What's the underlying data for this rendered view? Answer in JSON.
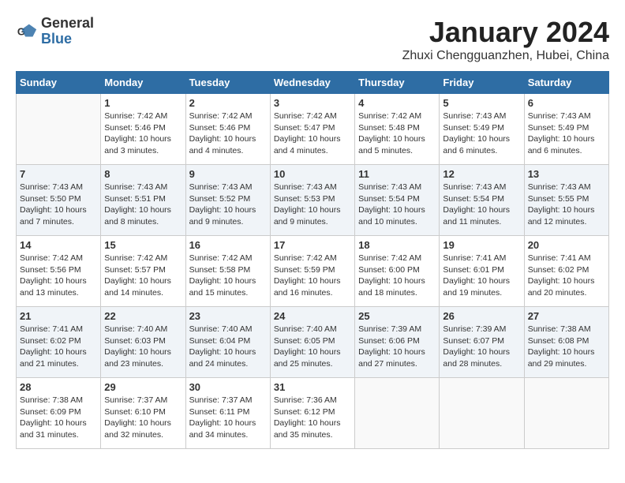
{
  "header": {
    "logo_general": "General",
    "logo_blue": "Blue",
    "month_title": "January 2024",
    "location": "Zhuxi Chengguanzhen, Hubei, China"
  },
  "days_of_week": [
    "Sunday",
    "Monday",
    "Tuesday",
    "Wednesday",
    "Thursday",
    "Friday",
    "Saturday"
  ],
  "weeks": [
    [
      {
        "date": "",
        "sunrise": "",
        "sunset": "",
        "daylight": "",
        "empty": true
      },
      {
        "date": "1",
        "sunrise": "Sunrise: 7:42 AM",
        "sunset": "Sunset: 5:46 PM",
        "daylight": "Daylight: 10 hours and 3 minutes."
      },
      {
        "date": "2",
        "sunrise": "Sunrise: 7:42 AM",
        "sunset": "Sunset: 5:46 PM",
        "daylight": "Daylight: 10 hours and 4 minutes."
      },
      {
        "date": "3",
        "sunrise": "Sunrise: 7:42 AM",
        "sunset": "Sunset: 5:47 PM",
        "daylight": "Daylight: 10 hours and 4 minutes."
      },
      {
        "date": "4",
        "sunrise": "Sunrise: 7:42 AM",
        "sunset": "Sunset: 5:48 PM",
        "daylight": "Daylight: 10 hours and 5 minutes."
      },
      {
        "date": "5",
        "sunrise": "Sunrise: 7:43 AM",
        "sunset": "Sunset: 5:49 PM",
        "daylight": "Daylight: 10 hours and 6 minutes."
      },
      {
        "date": "6",
        "sunrise": "Sunrise: 7:43 AM",
        "sunset": "Sunset: 5:49 PM",
        "daylight": "Daylight: 10 hours and 6 minutes."
      }
    ],
    [
      {
        "date": "7",
        "sunrise": "Sunrise: 7:43 AM",
        "sunset": "Sunset: 5:50 PM",
        "daylight": "Daylight: 10 hours and 7 minutes."
      },
      {
        "date": "8",
        "sunrise": "Sunrise: 7:43 AM",
        "sunset": "Sunset: 5:51 PM",
        "daylight": "Daylight: 10 hours and 8 minutes."
      },
      {
        "date": "9",
        "sunrise": "Sunrise: 7:43 AM",
        "sunset": "Sunset: 5:52 PM",
        "daylight": "Daylight: 10 hours and 9 minutes."
      },
      {
        "date": "10",
        "sunrise": "Sunrise: 7:43 AM",
        "sunset": "Sunset: 5:53 PM",
        "daylight": "Daylight: 10 hours and 9 minutes."
      },
      {
        "date": "11",
        "sunrise": "Sunrise: 7:43 AM",
        "sunset": "Sunset: 5:54 PM",
        "daylight": "Daylight: 10 hours and 10 minutes."
      },
      {
        "date": "12",
        "sunrise": "Sunrise: 7:43 AM",
        "sunset": "Sunset: 5:54 PM",
        "daylight": "Daylight: 10 hours and 11 minutes."
      },
      {
        "date": "13",
        "sunrise": "Sunrise: 7:43 AM",
        "sunset": "Sunset: 5:55 PM",
        "daylight": "Daylight: 10 hours and 12 minutes."
      }
    ],
    [
      {
        "date": "14",
        "sunrise": "Sunrise: 7:42 AM",
        "sunset": "Sunset: 5:56 PM",
        "daylight": "Daylight: 10 hours and 13 minutes."
      },
      {
        "date": "15",
        "sunrise": "Sunrise: 7:42 AM",
        "sunset": "Sunset: 5:57 PM",
        "daylight": "Daylight: 10 hours and 14 minutes."
      },
      {
        "date": "16",
        "sunrise": "Sunrise: 7:42 AM",
        "sunset": "Sunset: 5:58 PM",
        "daylight": "Daylight: 10 hours and 15 minutes."
      },
      {
        "date": "17",
        "sunrise": "Sunrise: 7:42 AM",
        "sunset": "Sunset: 5:59 PM",
        "daylight": "Daylight: 10 hours and 16 minutes."
      },
      {
        "date": "18",
        "sunrise": "Sunrise: 7:42 AM",
        "sunset": "Sunset: 6:00 PM",
        "daylight": "Daylight: 10 hours and 18 minutes."
      },
      {
        "date": "19",
        "sunrise": "Sunrise: 7:41 AM",
        "sunset": "Sunset: 6:01 PM",
        "daylight": "Daylight: 10 hours and 19 minutes."
      },
      {
        "date": "20",
        "sunrise": "Sunrise: 7:41 AM",
        "sunset": "Sunset: 6:02 PM",
        "daylight": "Daylight: 10 hours and 20 minutes."
      }
    ],
    [
      {
        "date": "21",
        "sunrise": "Sunrise: 7:41 AM",
        "sunset": "Sunset: 6:02 PM",
        "daylight": "Daylight: 10 hours and 21 minutes."
      },
      {
        "date": "22",
        "sunrise": "Sunrise: 7:40 AM",
        "sunset": "Sunset: 6:03 PM",
        "daylight": "Daylight: 10 hours and 23 minutes."
      },
      {
        "date": "23",
        "sunrise": "Sunrise: 7:40 AM",
        "sunset": "Sunset: 6:04 PM",
        "daylight": "Daylight: 10 hours and 24 minutes."
      },
      {
        "date": "24",
        "sunrise": "Sunrise: 7:40 AM",
        "sunset": "Sunset: 6:05 PM",
        "daylight": "Daylight: 10 hours and 25 minutes."
      },
      {
        "date": "25",
        "sunrise": "Sunrise: 7:39 AM",
        "sunset": "Sunset: 6:06 PM",
        "daylight": "Daylight: 10 hours and 27 minutes."
      },
      {
        "date": "26",
        "sunrise": "Sunrise: 7:39 AM",
        "sunset": "Sunset: 6:07 PM",
        "daylight": "Daylight: 10 hours and 28 minutes."
      },
      {
        "date": "27",
        "sunrise": "Sunrise: 7:38 AM",
        "sunset": "Sunset: 6:08 PM",
        "daylight": "Daylight: 10 hours and 29 minutes."
      }
    ],
    [
      {
        "date": "28",
        "sunrise": "Sunrise: 7:38 AM",
        "sunset": "Sunset: 6:09 PM",
        "daylight": "Daylight: 10 hours and 31 minutes."
      },
      {
        "date": "29",
        "sunrise": "Sunrise: 7:37 AM",
        "sunset": "Sunset: 6:10 PM",
        "daylight": "Daylight: 10 hours and 32 minutes."
      },
      {
        "date": "30",
        "sunrise": "Sunrise: 7:37 AM",
        "sunset": "Sunset: 6:11 PM",
        "daylight": "Daylight: 10 hours and 34 minutes."
      },
      {
        "date": "31",
        "sunrise": "Sunrise: 7:36 AM",
        "sunset": "Sunset: 6:12 PM",
        "daylight": "Daylight: 10 hours and 35 minutes."
      },
      {
        "date": "",
        "sunrise": "",
        "sunset": "",
        "daylight": "",
        "empty": true
      },
      {
        "date": "",
        "sunrise": "",
        "sunset": "",
        "daylight": "",
        "empty": true
      },
      {
        "date": "",
        "sunrise": "",
        "sunset": "",
        "daylight": "",
        "empty": true
      }
    ]
  ]
}
